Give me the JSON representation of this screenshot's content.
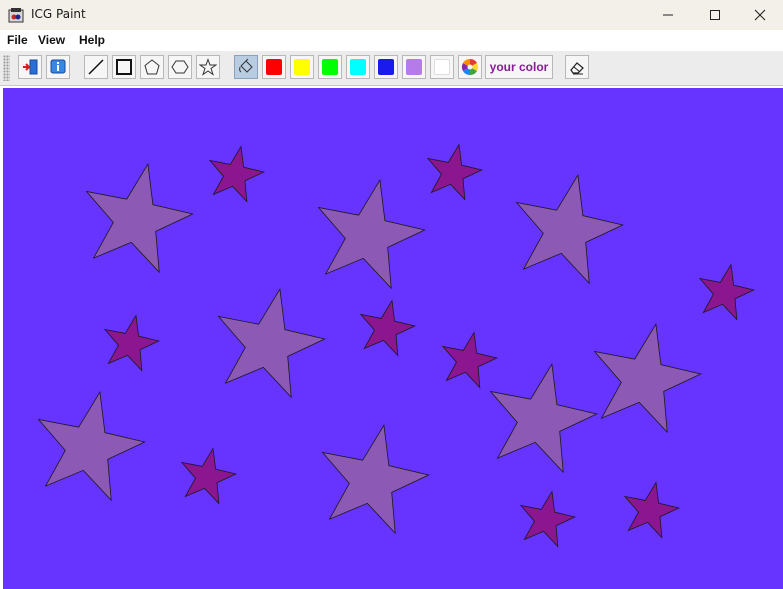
{
  "window": {
    "title": "ICG Paint"
  },
  "menu": {
    "items": [
      "File",
      "View",
      "Help"
    ]
  },
  "toolbar": {
    "custom_color_label": "your color",
    "swatch_colors": [
      "#ff0000",
      "#ffff00",
      "#00ff00",
      "#00ffff",
      "#1a1aee",
      "#b57bea",
      "#ffffff"
    ],
    "selected_tool": "fill"
  },
  "canvas": {
    "background_color": "#6633ff",
    "large_star_color": "#8c5ab4",
    "small_star_color": "#8b168f",
    "outline_color": "#1a1a1a"
  }
}
